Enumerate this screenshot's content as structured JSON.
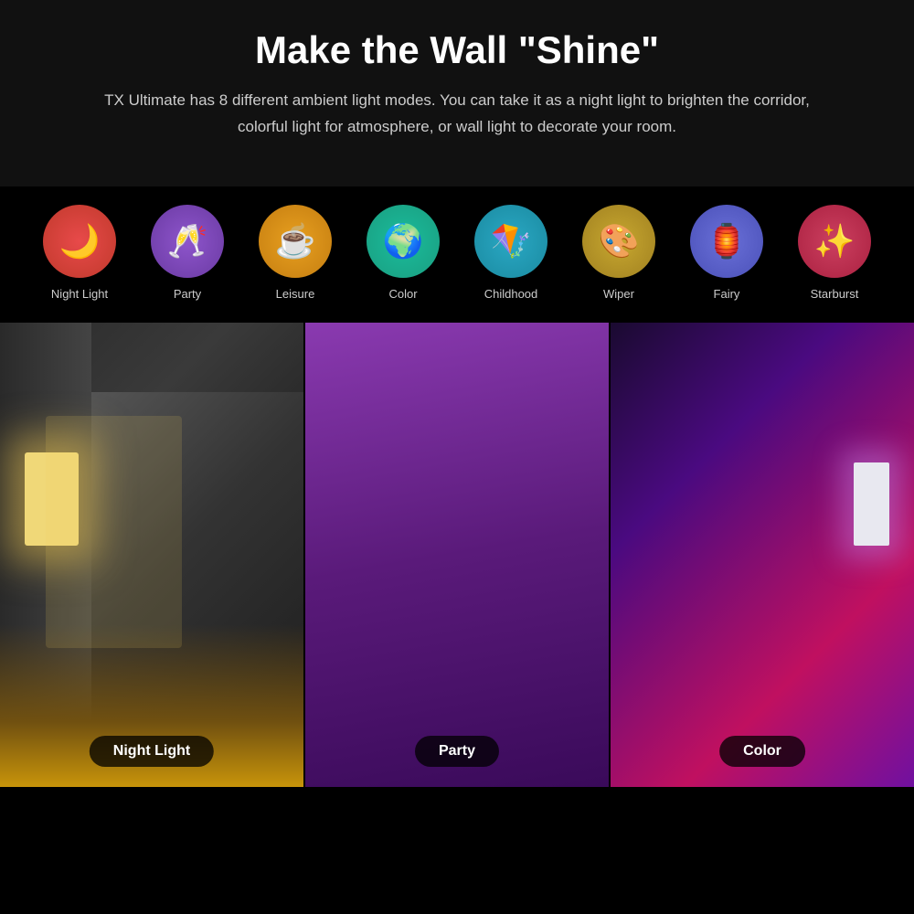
{
  "header": {
    "title": "Make the Wall \"Shine\"",
    "subtitle": "TX Ultimate has 8 different ambient light modes. You can take it as a night light to brighten the corridor, colorful light for atmosphere, or wall light to decorate your room."
  },
  "modes": [
    {
      "id": "night-light",
      "label": "Night Light",
      "icon": "🌙",
      "css_class": "mode-night"
    },
    {
      "id": "party",
      "label": "Party",
      "icon": "🥂",
      "css_class": "mode-party"
    },
    {
      "id": "leisure",
      "label": "Leisure",
      "icon": "☕",
      "css_class": "mode-leisure"
    },
    {
      "id": "color",
      "label": "Color",
      "icon": "🌍",
      "css_class": "mode-color"
    },
    {
      "id": "childhood",
      "label": "Childhood",
      "icon": "🪁",
      "css_class": "mode-childhood"
    },
    {
      "id": "wiper",
      "label": "Wiper",
      "icon": "🎨",
      "css_class": "mode-wiper"
    },
    {
      "id": "fairy",
      "label": "Fairy",
      "icon": "🏮",
      "css_class": "mode-fairy"
    },
    {
      "id": "starburst",
      "label": "Starburst",
      "icon": "✨",
      "css_class": "mode-starburst"
    }
  ],
  "photos": [
    {
      "id": "night-light-photo",
      "label": "Night Light",
      "css_class": "panel-night"
    },
    {
      "id": "party-photo",
      "label": "Party",
      "css_class": "panel-party"
    },
    {
      "id": "color-photo",
      "label": "Color",
      "css_class": "panel-color"
    }
  ]
}
